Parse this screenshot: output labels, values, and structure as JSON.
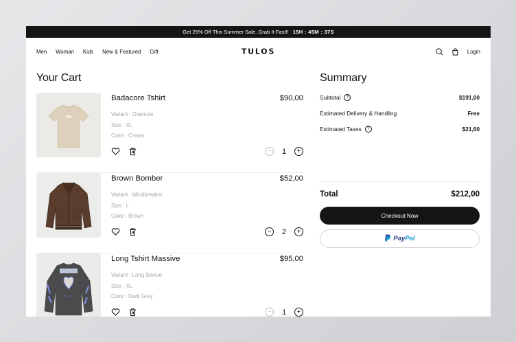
{
  "promo": {
    "text": "Get 25% Off This Summer Sale. Grab It Fast!!",
    "timer": "15H : 45M : 37S"
  },
  "nav": {
    "links": [
      "Men",
      "Woman",
      "Kids",
      "New & Featured",
      "Gift"
    ],
    "logo": "TULOS",
    "login": "Login",
    "icons": [
      "search-icon",
      "bag-icon"
    ]
  },
  "cart": {
    "title": "Your Cart",
    "items": [
      {
        "name": "Badacore Tshirt",
        "price": "$90,00",
        "variant": "Variant : Oversize",
        "size": "Size : XL",
        "color": "Color : Cream",
        "qty": "1",
        "image": "cream-tshirt"
      },
      {
        "name": "Brown Bomber",
        "price": "$52,00",
        "variant": "Variant : Windbreaker",
        "size": "Size : L",
        "color": "Color : Brown",
        "qty": "2",
        "image": "brown-bomber-jacket"
      },
      {
        "name": "Long Tshirt Massive",
        "price": "$95,00",
        "variant": "Variant : Long Sleeve",
        "size": "Size : XL",
        "color": "Color : Dark Grey",
        "qty": "1",
        "image": "dark-grey-long-sleeve"
      }
    ],
    "minus": "−",
    "plus": "+"
  },
  "summary": {
    "title": "Summary",
    "subtotal_label": "Subtotal",
    "subtotal": "$191,00",
    "delivery_label": "Estimated Delivery & Handling",
    "delivery": "Free",
    "taxes_label": "Estimated Taxes",
    "taxes": "$21,00",
    "total_label": "Total",
    "total": "$212,00",
    "checkout": "Checkout Now",
    "paypal_pay": "Pay",
    "paypal_pal": "Pal",
    "help_glyph": "?"
  },
  "colors": {
    "accent": "#151515",
    "muted": "#a6a6a6",
    "paypal_dark": "#253b80",
    "paypal_light": "#179bd7"
  }
}
